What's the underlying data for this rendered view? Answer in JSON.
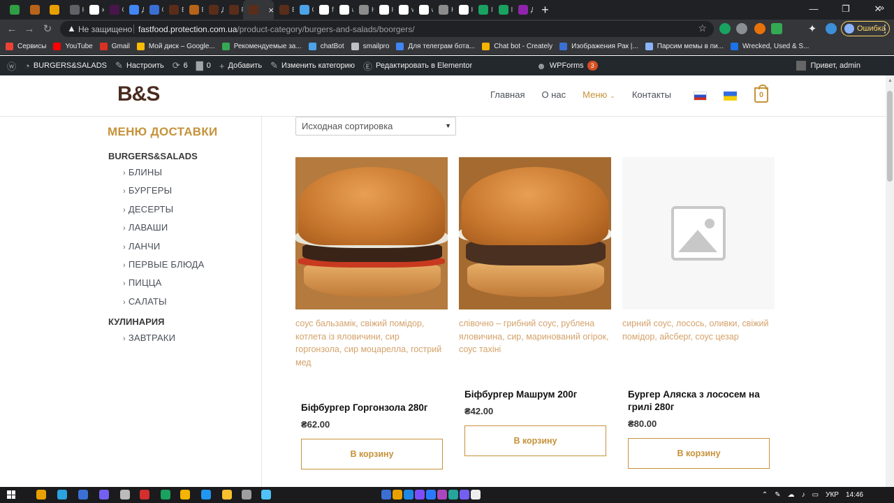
{
  "browser": {
    "tabs": [
      {
        "icon": "px-icon",
        "title": "",
        "color": "#2f9e44"
      },
      {
        "icon": "burger-icon",
        "title": "",
        "color": "#b7641a"
      },
      {
        "icon": "pinwheel-icon",
        "title": "",
        "color": "#e8a000"
      },
      {
        "icon": "page-icon",
        "title": "На",
        "color": "#5f6368"
      },
      {
        "icon": "google-icon",
        "title": "ка",
        "color": "#ffffff"
      },
      {
        "icon": "slack-icon",
        "title": "Ch",
        "color": "#4a154b"
      },
      {
        "icon": "doc-icon",
        "title": "Дл",
        "color": "#4285f4"
      },
      {
        "icon": "r-icon",
        "title": "От",
        "color": "#3b6fd4"
      },
      {
        "icon": "bs-icon",
        "title": "BU",
        "color": "#5a2d1a"
      },
      {
        "icon": "burger-icon",
        "title": "Бу",
        "color": "#b7641a"
      },
      {
        "icon": "bs-icon",
        "title": "До",
        "color": "#5a2d1a"
      },
      {
        "icon": "bs-icon",
        "title": "Ре",
        "color": "#5a2d1a"
      },
      {
        "icon": "bs-icon",
        "title": "",
        "color": "#5a2d1a",
        "active": true
      },
      {
        "icon": "bs-icon",
        "title": "BU",
        "color": "#5a2d1a"
      },
      {
        "icon": "share-icon",
        "title": "Ог",
        "color": "#4da3e8"
      },
      {
        "icon": "google-icon",
        "title": "fle",
        "color": "#ffffff"
      },
      {
        "icon": "google-icon",
        "title": "wc",
        "color": "#ffffff"
      },
      {
        "icon": "page-icon",
        "title": "Ка",
        "color": "#8c8c8c"
      },
      {
        "icon": "wordpress-icon",
        "title": "Ка",
        "color": "#ffffff"
      },
      {
        "icon": "google-icon",
        "title": "wc",
        "color": "#ffffff"
      },
      {
        "icon": "github-icon",
        "title": "wc",
        "color": "#ffffff"
      },
      {
        "icon": "page-icon",
        "title": "Ка",
        "color": "#8c8c8c"
      },
      {
        "icon": "wordpress-icon",
        "title": "Ка",
        "color": "#ffffff"
      },
      {
        "icon": "image-icon",
        "title": "Im",
        "color": "#1aa260"
      },
      {
        "icon": "image-icon",
        "title": "Im",
        "color": "#1aa260"
      },
      {
        "icon": "n-icon",
        "title": "До",
        "color": "#8e24aa"
      }
    ],
    "new_tab": "+",
    "window": {
      "minimize": "—",
      "restore": "❐",
      "close": "✕"
    },
    "insecure_label": "Не защищено",
    "url_host": "fastfood.protection.com.ua",
    "url_path": "/product-category/burgers-and-salads/boorgers/",
    "error_label": "Ошибка",
    "bookmarks": [
      {
        "label": "Сервисы",
        "color": "#ea4335"
      },
      {
        "label": "YouTube",
        "color": "#ff0000"
      },
      {
        "label": "Gmail",
        "color": "#d93025"
      },
      {
        "label": "Мой диск – Google...",
        "color": "#fbbc04"
      },
      {
        "label": "Рекомендуемые за...",
        "color": "#34a853"
      },
      {
        "label": "chatBot",
        "color": "#4da3e8"
      },
      {
        "label": "smailpro",
        "color": "#bdc1c6"
      },
      {
        "label": "Для телеграм бота...",
        "color": "#4285f4"
      },
      {
        "label": "Chat bot - Creately",
        "color": "#f4b400"
      },
      {
        "label": "Изображения Рак |...",
        "color": "#3b6fd4"
      },
      {
        "label": "Парсим мемы в пи...",
        "color": "#8ab4f8"
      },
      {
        "label": "Wrecked, Used & S...",
        "color": "#1a73e8"
      }
    ],
    "bookmarks_more": "»"
  },
  "adminbar": {
    "site_name": "BURGERS&SALADS",
    "customize": "Настроить",
    "updates": "6",
    "comments": "0",
    "add_new": "Добавить",
    "edit_category": "Изменить категорию",
    "edit_elementor": "Редактировать в Elementor",
    "wpforms": "WPForms",
    "wpforms_count": "3",
    "greeting": "Привет, admin"
  },
  "site": {
    "logo": "B&S",
    "nav": [
      {
        "label": "Главная"
      },
      {
        "label": "О нас"
      },
      {
        "label": "Меню",
        "active": true
      },
      {
        "label": "Контакты"
      }
    ],
    "cart_count": "0",
    "accent": "#c6923a"
  },
  "sidebar": {
    "title": "МЕНЮ ДОСТАВКИ",
    "cat1": "BURGERS&SALADS",
    "items1": [
      "БЛИНЫ",
      "БУРГЕРЫ",
      "ДЕСЕРТЫ",
      "ЛАВАШИ",
      "ЛАНЧИ",
      "ПЕРВЫЕ БЛЮДА",
      "ПИЦЦА",
      "САЛАТЫ"
    ],
    "cat2": "КУЛИНАРИЯ",
    "items2": [
      "ЗАВТРАКИ"
    ]
  },
  "sort": {
    "selected": "Исходная сортировка"
  },
  "products": [
    {
      "desc": "соус бальзамік, свіжий помідор, котлета із яловичини, сир горгонзола, сир моцарелла, гострий мед",
      "name": "Біфбургер Горгонзола 280г",
      "price": "₴62.00",
      "button": "В корзину"
    },
    {
      "desc": "слівочно – грибний соус, рублена яловичина, сир, маринований огірок, соус тахіні",
      "name": "Біфбургер Машрум 200г",
      "price": "₴42.00",
      "button": "В корзину"
    },
    {
      "desc": "сирний соус, лосось, оливки, свіжий помідор, айсберг, соус цезар",
      "name": "Бургер Аляска з лососем на грилі 280г",
      "price": "₴80.00",
      "button": "В корзину"
    }
  ],
  "taskbar": {
    "lang": "УКР",
    "time": "14:46"
  }
}
